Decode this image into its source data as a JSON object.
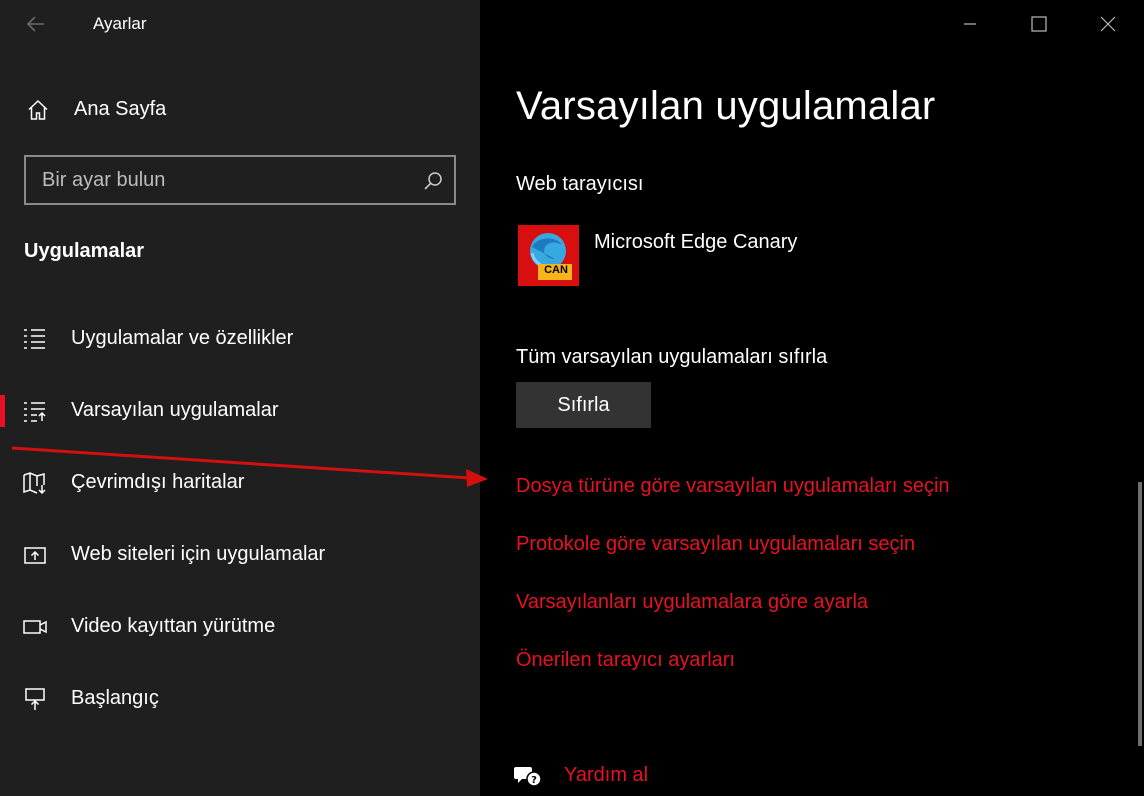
{
  "window": {
    "title": "Ayarlar",
    "controls": [
      "minimize-icon",
      "maximize-icon",
      "close-icon"
    ]
  },
  "sidebar": {
    "home_label": "Ana Sayfa",
    "search_placeholder": "Bir ayar bulun",
    "section_title": "Uygulamalar",
    "items": [
      {
        "label": "Uygulamalar ve özellikler",
        "icon": "apps-features-icon",
        "active": false
      },
      {
        "label": "Varsayılan uygulamalar",
        "icon": "default-apps-icon",
        "active": true
      },
      {
        "label": "Çevrimdışı haritalar",
        "icon": "offline-maps-icon",
        "active": false
      },
      {
        "label": "Web siteleri için uygulamalar",
        "icon": "apps-for-websites-icon",
        "active": false
      },
      {
        "label": "Video kayıttan yürütme",
        "icon": "video-playback-icon",
        "active": false
      },
      {
        "label": "Başlangıç",
        "icon": "startup-icon",
        "active": false
      }
    ]
  },
  "main": {
    "page_title": "Varsayılan uygulamalar",
    "web_browser_label": "Web tarayıcısı",
    "browser_name": "Microsoft Edge Canary",
    "browser_badge": "CAN",
    "reset_label": "Tüm varsayılan uygulamaları sıfırla",
    "reset_button": "Sıfırla",
    "links": [
      "Dosya türüne göre varsayılan uygulamaları seçin",
      "Protokole göre varsayılan uygulamaları seçin",
      "Varsayılanları uygulamalara göre ayarla",
      "Önerilen tarayıcı ayarları"
    ],
    "help_label": "Yardım al"
  },
  "colors": {
    "accent": "#e81123",
    "sidebar_bg": "#1f1f1f",
    "main_bg": "#000000",
    "button_bg": "#333333"
  }
}
